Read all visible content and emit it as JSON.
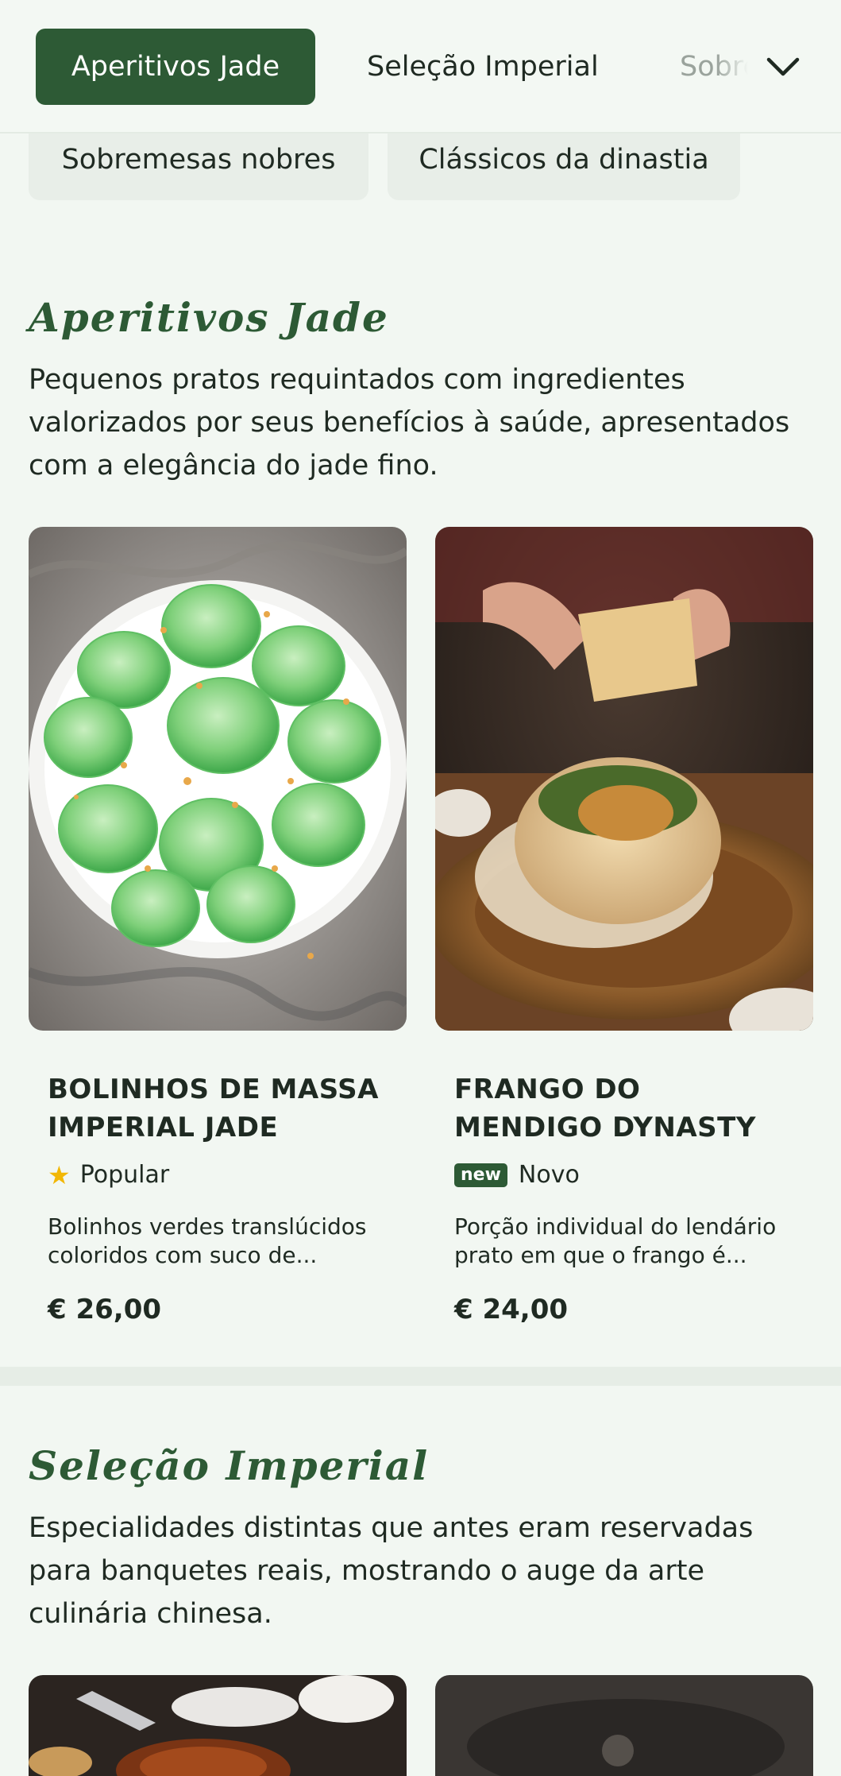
{
  "nav": {
    "tabs": [
      {
        "label": "Aperitivos Jade",
        "active": true
      },
      {
        "label": "Seleção Imperial",
        "active": false
      },
      {
        "label": "Sobremesas nobres",
        "active": false
      }
    ],
    "overflow_chips": [
      "Sobremesas nobres",
      "Clássicos da dinastia"
    ],
    "expand_icon": "chevron-down-icon"
  },
  "sections": [
    {
      "title": "Aperitivos Jade",
      "description": "Pequenos pratos requintados com ingredientes valorizados por seus benefícios à saúde, apresentados com a elegância do jade fino.",
      "items": [
        {
          "name": "BOLINHOS DE MASSA IMPERIAL JADE",
          "badge_icon": "star-icon",
          "badge": "Popular",
          "description": "Bolinhos verdes translúcidos coloridos com suco de...",
          "price": "€ 26,00"
        },
        {
          "name": "FRANGO DO MENDIGO DYNASTY",
          "badge_icon": "new-tag",
          "badge_tag": "new",
          "badge": "Novo",
          "description": "Porção individual do lendário prato em que o frango é...",
          "price": "€ 24,00"
        }
      ]
    },
    {
      "title": "Seleção Imperial",
      "description": "Especialidades distintas que antes eram reservadas para banquetes reais, mostrando o auge da arte culinária chinesa."
    }
  ],
  "colors": {
    "accent": "#2d5a35",
    "background": "#f2f7f2",
    "chip_bg": "#e8eee8",
    "star": "#f2b705"
  }
}
